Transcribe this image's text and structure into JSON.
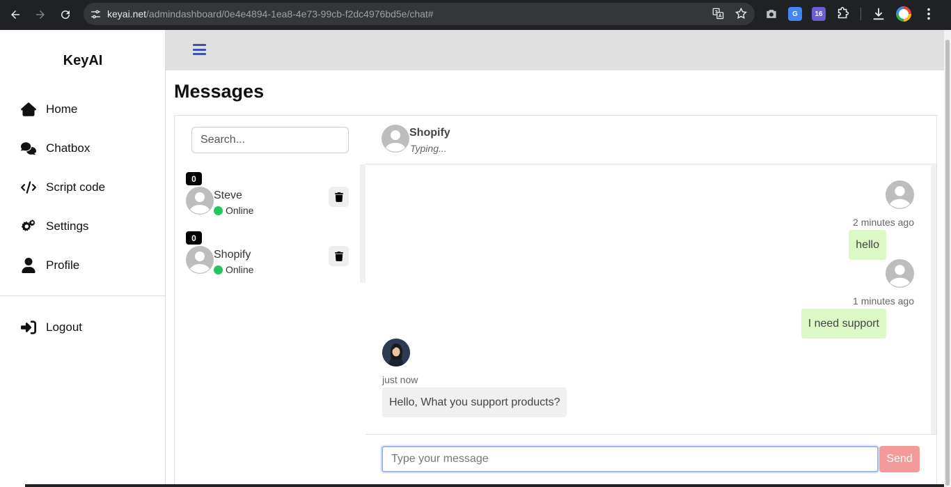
{
  "browser": {
    "url_host": "keyai.net",
    "url_path": "/admindashboard/0e4e4894-1ea8-4e73-99cb-f2dc4976bd5e/chat#",
    "calendar_badge": "16"
  },
  "sidebar": {
    "brand": "KeyAI",
    "items": [
      {
        "label": "Home",
        "icon": "home-icon"
      },
      {
        "label": "Chatbox",
        "icon": "chat-bubbles-icon"
      },
      {
        "label": "Script code",
        "icon": "code-icon"
      },
      {
        "label": "Settings",
        "icon": "gears-icon"
      },
      {
        "label": "Profile",
        "icon": "user-icon"
      }
    ],
    "logout": "Logout"
  },
  "page": {
    "title": "Messages"
  },
  "contacts": {
    "search_placeholder": "Search...",
    "list": [
      {
        "name": "Steve",
        "status": "Online",
        "unread": "0"
      },
      {
        "name": "Shopify",
        "status": "Online",
        "unread": "0"
      }
    ]
  },
  "chat": {
    "name": "Shopify",
    "status": "Typing...",
    "messages": [
      {
        "side": "out",
        "time": "2 minutes ago",
        "text": "hello"
      },
      {
        "side": "out",
        "time": "1 minutes ago",
        "text": "I need support"
      },
      {
        "side": "in",
        "time": "just now",
        "text": "Hello, What you support products?"
      }
    ],
    "input_placeholder": "Type your message",
    "send_label": "Send"
  },
  "colors": {
    "sent_bubble": "#dcf8c6",
    "received_bubble": "#f0f0f0",
    "online": "#22c55e",
    "send_button": "#f59a9a",
    "accent": "#3f51b5"
  }
}
